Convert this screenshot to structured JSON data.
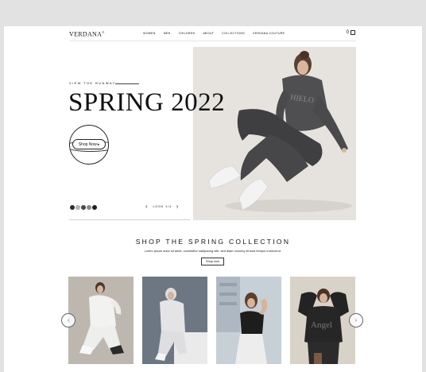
{
  "header": {
    "logo": "VERDANA",
    "logo_mark": "®",
    "nav": [
      "WOMEN",
      "MEN",
      "CHILDREN",
      "ABOUT",
      "COLLECTIONS",
      "VERDANA COUTURE"
    ],
    "cart_count": "0"
  },
  "hero": {
    "eyebrow": "VIEW THE RUNWAY",
    "title": "SPRING 2022",
    "cta_label": "Shop Now",
    "cta_arrow": "▸",
    "lookbook_label": "LOOK 1/4",
    "prev_arrow": "‹",
    "next_arrow": "›",
    "swatch_colors": [
      "#2b2b2b",
      "#b9b4ad",
      "#4a4744",
      "#8d8a86",
      "#1f1f1f"
    ]
  },
  "collection": {
    "title": "SHOP THE SPRING COLLECTION",
    "description": "Lorem ipsum dolor sit amet, consetetur sadipscing elitr, sed diam nonumy eirmod tempor invidunt ut.",
    "button_label": "Shop now",
    "prev_arrow": "‹",
    "next_arrow": "›"
  },
  "colors": {
    "background": "#e2e2e2",
    "page": "#ffffff",
    "text": "#111111"
  }
}
